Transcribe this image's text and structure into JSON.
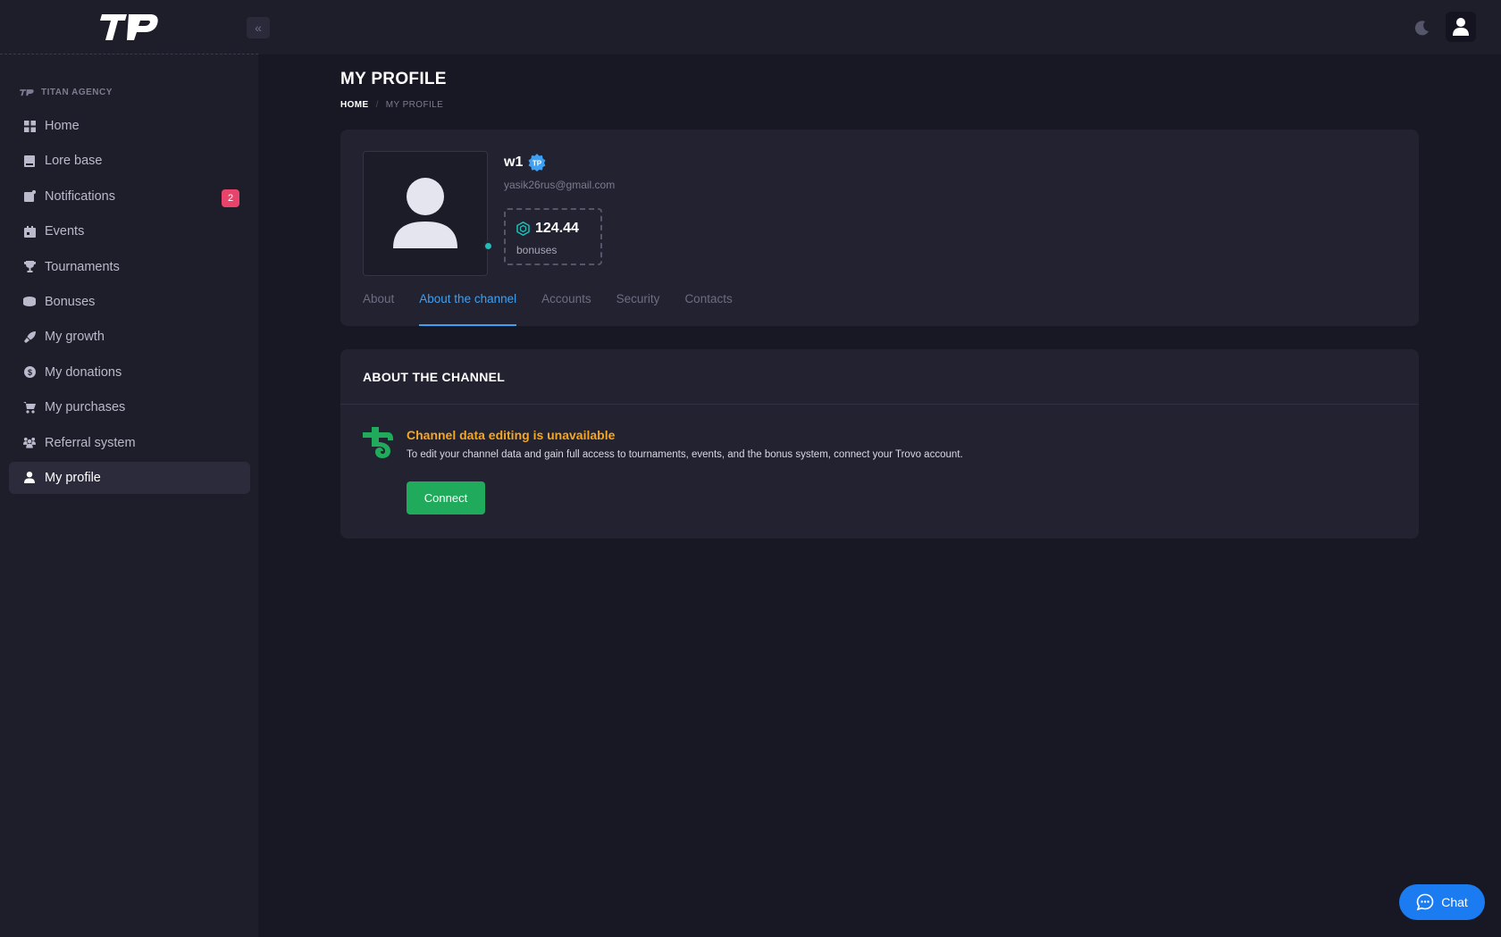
{
  "header": {
    "logo_text": "TP",
    "collapse_icon": "double-chevron-left-icon",
    "theme_icon": "moon-icon",
    "user_icon": "user-icon"
  },
  "sidebar": {
    "section_label": "TITAN AGENCY",
    "items": [
      {
        "label": "Home",
        "icon": "dashboard-icon"
      },
      {
        "label": "Lore base",
        "icon": "book-icon"
      },
      {
        "label": "Notifications",
        "icon": "notification-icon",
        "badge": "2"
      },
      {
        "label": "Events",
        "icon": "calendar-icon"
      },
      {
        "label": "Tournaments",
        "icon": "trophy-icon"
      },
      {
        "label": "Bonuses",
        "icon": "coins-icon"
      },
      {
        "label": "My growth",
        "icon": "rocket-icon"
      },
      {
        "label": "My donations",
        "icon": "dollar-icon"
      },
      {
        "label": "My purchases",
        "icon": "cart-icon"
      },
      {
        "label": "Referral system",
        "icon": "users-icon"
      },
      {
        "label": "My profile",
        "icon": "user-icon",
        "active": true
      }
    ]
  },
  "page": {
    "title": "MY PROFILE",
    "breadcrumb": {
      "home": "HOME",
      "separator": "/",
      "current": "MY PROFILE"
    }
  },
  "profile": {
    "username": "w1",
    "email": "yasik26rus@gmail.com",
    "bonus_value": "124.44",
    "bonus_label": "bonuses",
    "tabs": [
      "About",
      "About the channel",
      "Accounts",
      "Security",
      "Contacts"
    ],
    "active_tab": "About the channel"
  },
  "channel": {
    "heading": "ABOUT THE CHANNEL",
    "warning_title": "Channel data editing is unavailable",
    "warning_text": "To edit your channel data and gain full access to tournaments, events, and the bonus system, connect your Trovo account.",
    "connect_label": "Connect"
  },
  "chat": {
    "label": "Chat"
  },
  "colors": {
    "accent_blue": "#3ea0f2",
    "warning": "#f5a623",
    "connect_green": "#1faa5c",
    "badge_red": "#e8436a",
    "online_teal": "#1fbfb8"
  }
}
